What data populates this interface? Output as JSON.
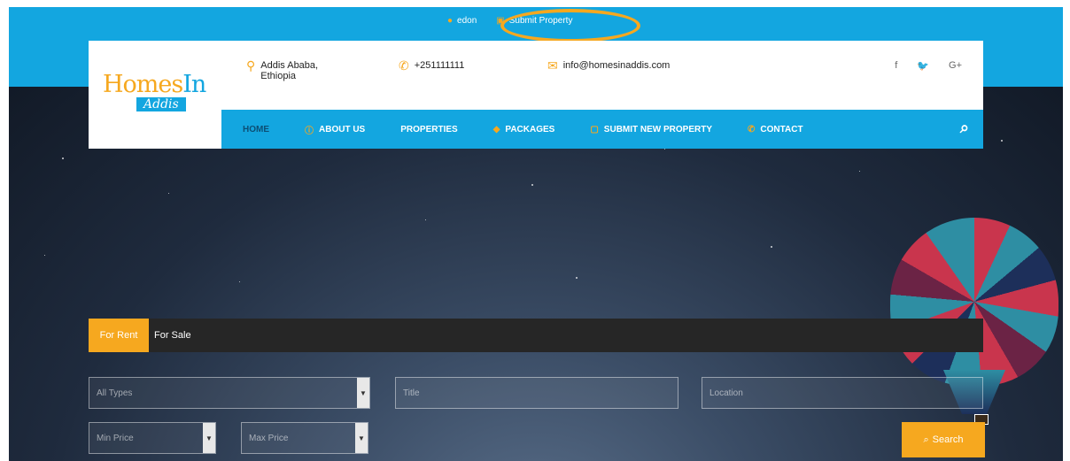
{
  "topbar": {
    "user_link": "edon",
    "submit_link": "Submit Property"
  },
  "logo": {
    "brand_main": "Homes",
    "brand_in": "In",
    "brand_sub": "Addis"
  },
  "contact": {
    "address_line1": "Addis Ababa,",
    "address_line2": "Ethiopia",
    "phone": "+251111111",
    "email": "info@homesinaddis.com"
  },
  "social": {
    "facebook": "f",
    "twitter": "🐦",
    "google": "G+"
  },
  "nav": {
    "items": [
      {
        "label": "HOME",
        "icon": "none"
      },
      {
        "label": "ABOUT US",
        "icon": "info-icon"
      },
      {
        "label": "PROPERTIES",
        "icon": "none"
      },
      {
        "label": "PACKAGES",
        "icon": "packages-icon"
      },
      {
        "label": "SUBMIT NEW PROPERTY",
        "icon": "submit-icon"
      },
      {
        "label": "CONTACT",
        "icon": "phone-icon"
      }
    ]
  },
  "tabs": {
    "rent": "For Rent",
    "sale": "For Sale"
  },
  "form": {
    "type_placeholder": "All Types",
    "title_placeholder": "Title",
    "location_placeholder": "Location",
    "min_price_placeholder": "Min Price",
    "max_price_placeholder": "Max Price",
    "search_label": "Search"
  },
  "colors": {
    "primary": "#13a6e0",
    "accent": "#f6a81f",
    "dark": "#262626"
  }
}
